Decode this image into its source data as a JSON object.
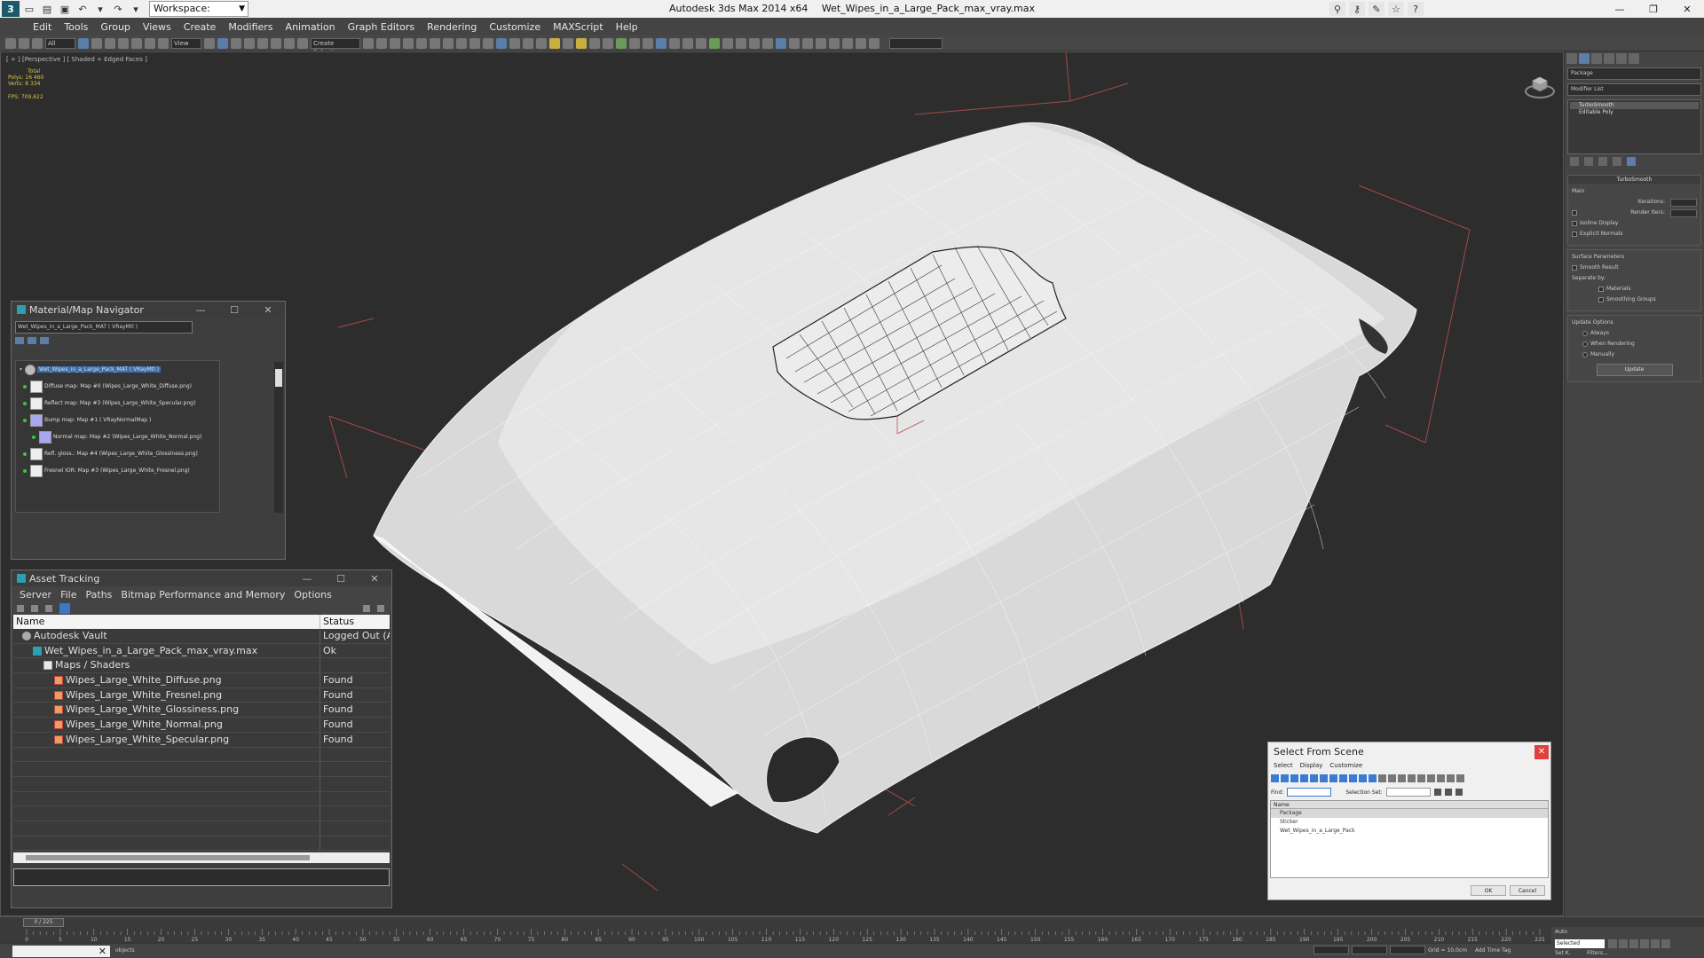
{
  "titlebar": {
    "workspace_label": "Workspace: Default",
    "app_name": "Autodesk 3ds Max  2014 x64",
    "file_name": "Wet_Wipes_in_a_Large_Pack_max_vray.max"
  },
  "menu": [
    "Edit",
    "Tools",
    "Group",
    "Views",
    "Create",
    "Modifiers",
    "Animation",
    "Graph Editors",
    "Rendering",
    "Customize",
    "MAXScript",
    "Help"
  ],
  "toolbar": {
    "selection_filter": "All",
    "ref_coord": "View",
    "named_selection": "Create Selection"
  },
  "viewport": {
    "label": "[ + ] [Perspective ] [ Shaded + Edged Faces ]",
    "stats_total": "Total",
    "stats_polys_label": "Polys:",
    "stats_polys": "16 460",
    "stats_verts_label": "Verts:",
    "stats_verts": "8 334",
    "fps_label": "FPS:",
    "fps": "709,622"
  },
  "command_panel": {
    "object_name": "Package",
    "modifier_list": "Modifier List",
    "stack": [
      "TurboSmooth",
      "Editable Poly"
    ],
    "turbosmooth_title": "TurboSmooth",
    "main_label": "Main",
    "iterations_label": "Iterations:",
    "render_iters_label": "Render Iters:",
    "isoline_label": "Isoline Display",
    "explicit_normals_label": "Explicit Normals",
    "surface_params_label": "Surface Parameters",
    "smooth_result_label": "Smooth Result",
    "separate_by_label": "Separate by:",
    "materials_label": "Materials",
    "smoothing_groups_label": "Smoothing Groups",
    "update_options_label": "Update Options",
    "always_label": "Always",
    "when_rendering_label": "When Rendering",
    "manually_label": "Manually",
    "update_button": "Update"
  },
  "material_navigator": {
    "title": "Material/Map Navigator",
    "path": "Wet_Wipes_in_a_Large_Pack_MAT  ( VRayMtl )",
    "items": [
      "Wet_Wipes_in_a_Large_Pack_MAT  ( VRayMtl )",
      "Diffuse map: Map #0 (Wipes_Large_White_Diffuse.png)",
      "Reflect map: Map #3 (Wipes_Large_White_Specular.png)",
      "Bump map: Map #1  ( VRayNormalMap )",
      "Normal map: Map #2 (Wipes_Large_White_Normal.png)",
      "Refl. gloss.: Map #4 (Wipes_Large_White_Glossiness.png)",
      "Fresnel IOR: Map #3 (Wipes_Large_White_Fresnel.png)"
    ]
  },
  "asset_tracking": {
    "title": "Asset Tracking",
    "menu": [
      "Server",
      "File",
      "Paths",
      "Bitmap Performance and Memory",
      "Options"
    ],
    "col_name": "Name",
    "col_status": "Status",
    "rows": [
      {
        "name": "Autodesk Vault",
        "status": "Logged Out (Ass...",
        "icon": "vault-icon",
        "indent": 1
      },
      {
        "name": "Wet_Wipes_in_a_Large_Pack_max_vray.max",
        "status": "Ok",
        "icon": "max-file-icon",
        "indent": 2
      },
      {
        "name": "Maps / Shaders",
        "status": "",
        "icon": "folder-icon",
        "indent": 3
      },
      {
        "name": "Wipes_Large_White_Diffuse.png",
        "status": "Found",
        "icon": "image-file-icon",
        "indent": 4
      },
      {
        "name": "Wipes_Large_White_Fresnel.png",
        "status": "Found",
        "icon": "image-file-icon",
        "indent": 4
      },
      {
        "name": "Wipes_Large_White_Glossiness.png",
        "status": "Found",
        "icon": "image-file-icon",
        "indent": 4
      },
      {
        "name": "Wipes_Large_White_Normal.png",
        "status": "Found",
        "icon": "image-file-icon",
        "indent": 4
      },
      {
        "name": "Wipes_Large_White_Specular.png",
        "status": "Found",
        "icon": "image-file-icon",
        "indent": 4
      }
    ]
  },
  "select_from_scene": {
    "title": "Select From Scene",
    "menu": [
      "Select",
      "Display",
      "Customize"
    ],
    "find_label": "Find:",
    "selection_set_label": "Selection Set:",
    "col_name": "Name",
    "items": [
      "Package",
      "Sticker",
      "Wet_Wipes_in_a_Large_Pack"
    ],
    "ok_button": "OK",
    "cancel_button": "Cancel"
  },
  "timeline": {
    "slider_label": "0 / 225",
    "ticks": [
      "0",
      "5",
      "10",
      "15",
      "20",
      "25",
      "30",
      "35",
      "40",
      "45",
      "50",
      "55",
      "60",
      "65",
      "70",
      "75",
      "80",
      "85",
      "90",
      "95",
      "100",
      "105",
      "110",
      "115",
      "120",
      "125",
      "130",
      "135",
      "140",
      "145",
      "150",
      "155",
      "160",
      "165",
      "170",
      "175",
      "180",
      "185",
      "190",
      "195",
      "200",
      "205",
      "210",
      "215",
      "220",
      "225"
    ]
  },
  "statusbar": {
    "message": "objects",
    "grid": "Grid = 10,0cm",
    "auto_label": "Auto",
    "set_key_label": "Set K.",
    "add_time_tag": "Add Time Tag",
    "selected_label": "Selected",
    "filters_label": "Filters..."
  }
}
